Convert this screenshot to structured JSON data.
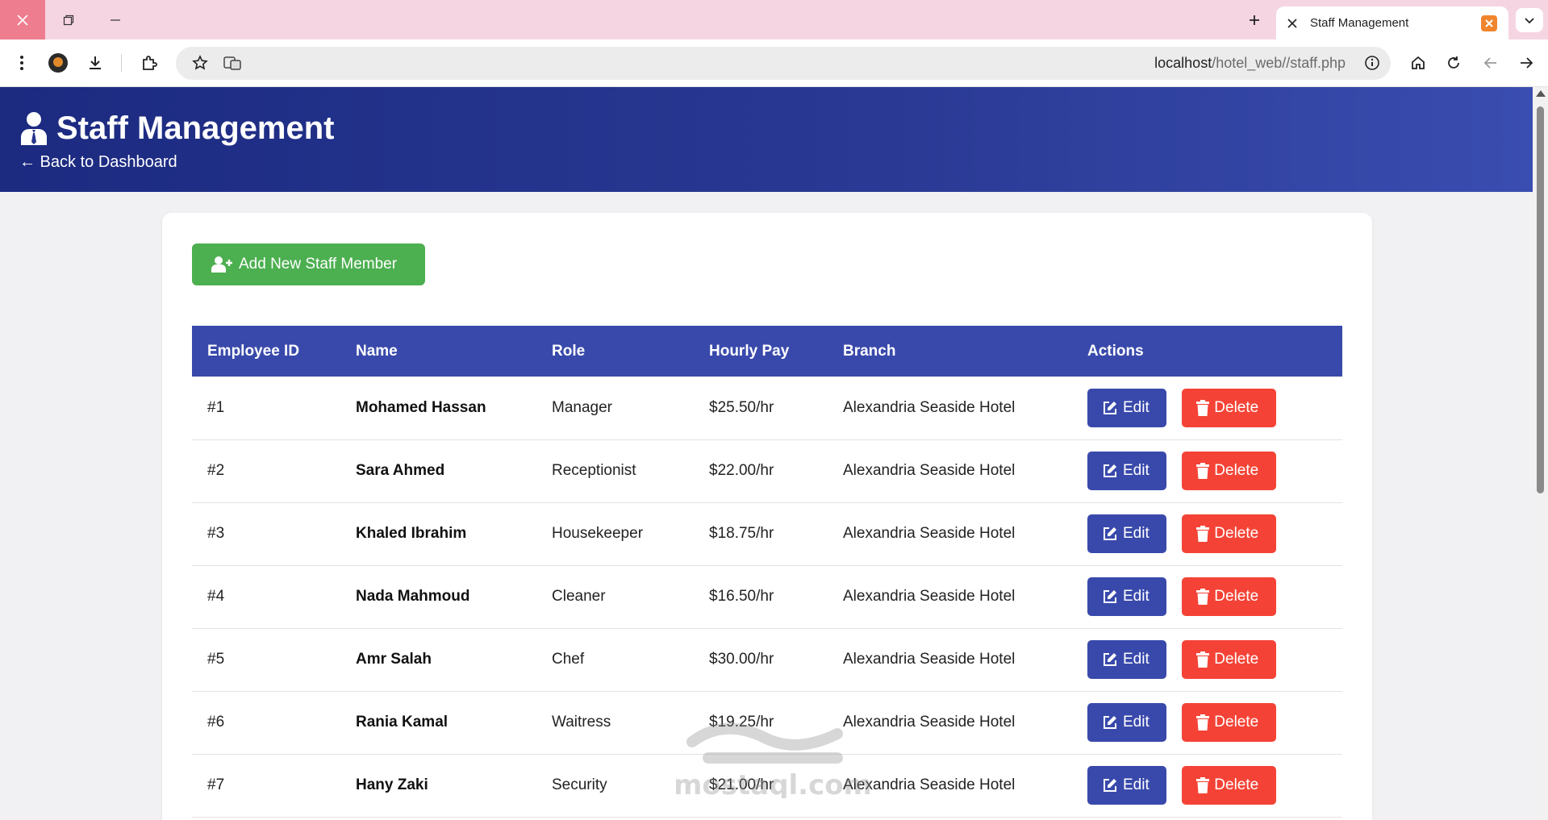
{
  "browser": {
    "tab_title": "Staff Management",
    "url_host": "localhost",
    "url_path": "/hotel_web//staff.php"
  },
  "header": {
    "title": "Staff Management",
    "back_link": "← Back to Dashboard"
  },
  "actions": {
    "add_label": "Add New Staff Member"
  },
  "table": {
    "columns": [
      "Employee ID",
      "Name",
      "Role",
      "Hourly Pay",
      "Branch",
      "Actions"
    ],
    "edit_label": "Edit",
    "delete_label": "Delete",
    "rows": [
      {
        "id": "#1",
        "name": "Mohamed Hassan",
        "role": "Manager",
        "pay": "$25.50/hr",
        "branch": "Alexandria Seaside Hotel"
      },
      {
        "id": "#2",
        "name": "Sara Ahmed",
        "role": "Receptionist",
        "pay": "$22.00/hr",
        "branch": "Alexandria Seaside Hotel"
      },
      {
        "id": "#3",
        "name": "Khaled Ibrahim",
        "role": "Housekeeper",
        "pay": "$18.75/hr",
        "branch": "Alexandria Seaside Hotel"
      },
      {
        "id": "#4",
        "name": "Nada Mahmoud",
        "role": "Cleaner",
        "pay": "$16.50/hr",
        "branch": "Alexandria Seaside Hotel"
      },
      {
        "id": "#5",
        "name": "Amr Salah",
        "role": "Chef",
        "pay": "$30.00/hr",
        "branch": "Alexandria Seaside Hotel"
      },
      {
        "id": "#6",
        "name": "Rania Kamal",
        "role": "Waitress",
        "pay": "$19.25/hr",
        "branch": "Alexandria Seaside Hotel"
      },
      {
        "id": "#7",
        "name": "Hany Zaki",
        "role": "Security",
        "pay": "$21.00/hr",
        "branch": "Alexandria Seaside Hotel"
      }
    ]
  },
  "colors": {
    "header_dark": "#1c2a80",
    "primary": "#3949ab",
    "success": "#4caf50",
    "danger": "#f44336"
  },
  "watermark": "mostaql.com"
}
